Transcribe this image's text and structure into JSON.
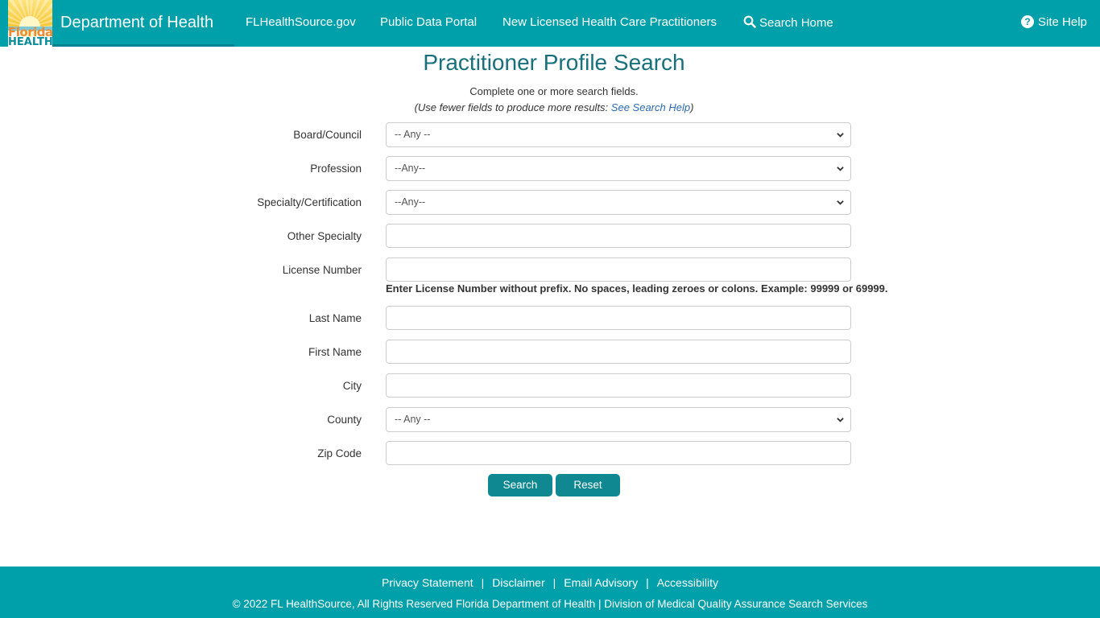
{
  "header": {
    "logo": {
      "line1": "Florida",
      "line2": "HEALTH"
    },
    "department": "Department of Health",
    "nav": [
      {
        "label": "FLHealthSource.gov"
      },
      {
        "label": "Public Data Portal"
      },
      {
        "label": "New Licensed Health Care Practitioners"
      },
      {
        "label": "Search Home",
        "icon": "search-icon"
      }
    ],
    "site_help": {
      "label": "Site Help",
      "icon": "question-circle-icon",
      "glyph": "?"
    }
  },
  "main": {
    "title": "Practitioner Profile Search",
    "subtitle": "Complete one or more search fields.",
    "hint_prefix": "(Use fewer fields to produce more results: ",
    "hint_link": "See Search Help",
    "hint_suffix": ")",
    "fields": {
      "board": {
        "label": "Board/Council",
        "value": "-- Any --"
      },
      "profession": {
        "label": "Profession",
        "value": "--Any--"
      },
      "specialty": {
        "label": "Specialty/Certification",
        "value": "--Any--"
      },
      "other_specialty": {
        "label": "Other Specialty",
        "value": ""
      },
      "license_number": {
        "label": "License Number",
        "value": "",
        "note": "Enter License Number without prefix. No spaces, leading zeroes or colons. Example: 99999 or 69999."
      },
      "last_name": {
        "label": "Last Name",
        "value": ""
      },
      "first_name": {
        "label": "First Name",
        "value": ""
      },
      "city": {
        "label": "City",
        "value": ""
      },
      "county": {
        "label": "County",
        "value": "-- Any --"
      },
      "zip": {
        "label": "Zip Code",
        "value": ""
      }
    },
    "buttons": {
      "search": "Search",
      "reset": "Reset"
    }
  },
  "footer": {
    "links": [
      "Privacy Statement",
      "Disclaimer",
      "Email Advisory",
      "Accessibility"
    ],
    "separator": "|",
    "copyright": "© 2022 FL HealthSource, All Rights Reserved Florida Department of Health | Division of Medical Quality Assurance Search Services"
  },
  "colors": {
    "brand": "#00a0ab",
    "title": "#17707c",
    "button": "#0f8891",
    "link": "#2a6ab5"
  }
}
